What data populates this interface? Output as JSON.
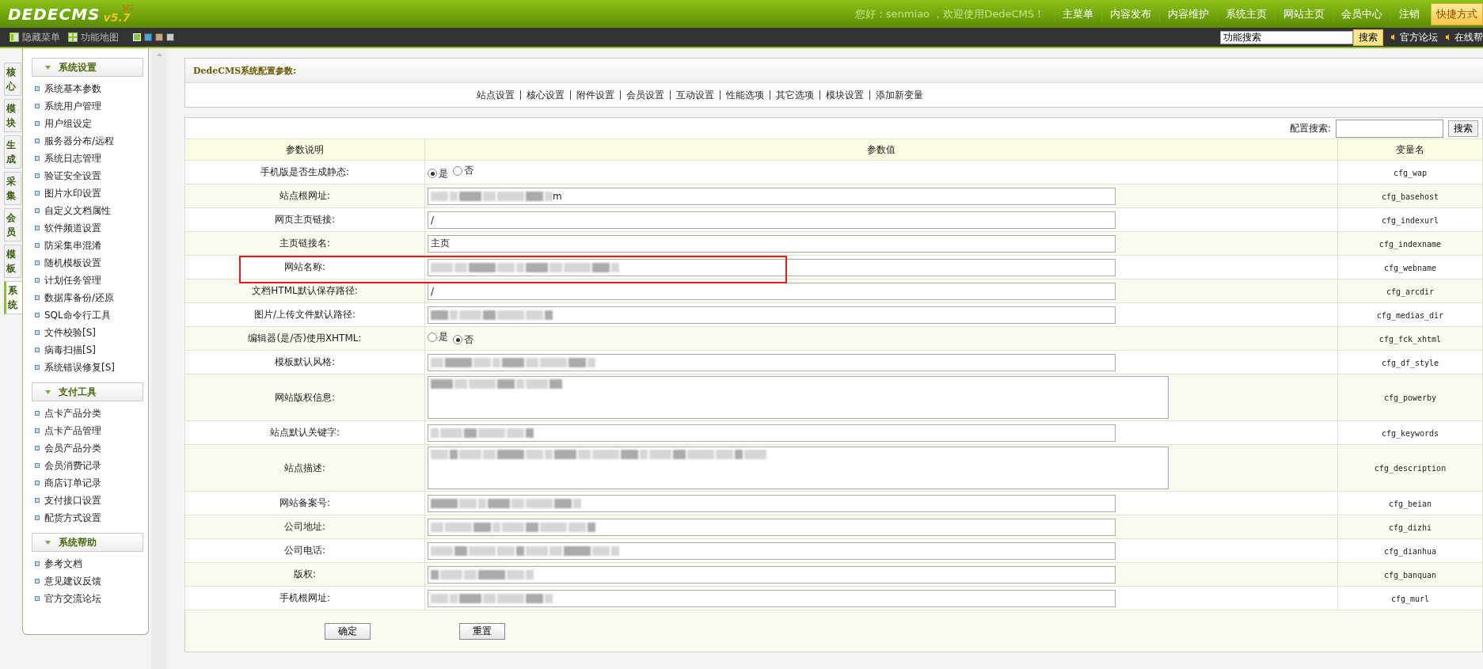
{
  "logo": {
    "name": "DEDECMS",
    "version": "v5.7",
    "edition": "SP2"
  },
  "greeting": "您好：senmiao ，欢迎使用DedeCMS！",
  "top_links": [
    "主菜单",
    "内容发布",
    "内容维护",
    "系统主页",
    "网站主页",
    "会员中心",
    "注销"
  ],
  "shortcut_button": "快捷方式",
  "toolbar": {
    "hide_menu": "隐藏菜单",
    "site_map": "功能地图",
    "skins": [
      {
        "color": "#8cc63f",
        "selected": true
      },
      {
        "color": "#3fa9e0",
        "selected": false
      },
      {
        "color": "#c8a878",
        "selected": false
      },
      {
        "color": "#c8c8c8",
        "selected": false
      }
    ],
    "search_value": "功能搜索",
    "search_button": "搜索",
    "links": [
      "官方论坛",
      "在线帮"
    ]
  },
  "side_tabs": [
    {
      "label": "核心",
      "selected": false
    },
    {
      "label": "模块",
      "selected": false
    },
    {
      "label": "生成",
      "selected": false
    },
    {
      "label": "采集",
      "selected": false
    },
    {
      "label": "会员",
      "selected": false
    },
    {
      "label": "模板",
      "selected": false
    },
    {
      "label": "系统",
      "selected": true
    }
  ],
  "menu_groups": [
    {
      "title": "系统设置",
      "items": [
        "系统基本参数",
        "系统用户管理",
        "用户组设定",
        "服务器分布/远程",
        "系统日志管理",
        "验证安全设置",
        "图片水印设置",
        "自定义文档属性",
        "软件频道设置",
        "防采集串混淆",
        "随机模板设置",
        "计划任务管理",
        "数据库备份/还原",
        "SQL命令行工具",
        "文件校验[S]",
        "病毒扫描[S]",
        "系统错误修复[S]"
      ]
    },
    {
      "title": "支付工具",
      "items": [
        "点卡产品分类",
        "点卡产品管理",
        "会员产品分类",
        "会员消费记录",
        "商店订单记录",
        "支付接口设置",
        "配货方式设置"
      ]
    },
    {
      "title": "系统帮助",
      "items": [
        "参考文档",
        "意见建议反馈",
        "官方交流论坛"
      ]
    }
  ],
  "panel_title": "DedeCMS系统配置参数:",
  "config_tabs": [
    "站点设置",
    "核心设置",
    "附件设置",
    "会员设置",
    "互动设置",
    "性能选项",
    "其它选项",
    "模块设置",
    "添加新变量"
  ],
  "config_search": {
    "label": "配置搜索:",
    "button": "搜索"
  },
  "table": {
    "columns": [
      "参数说明",
      "参数值",
      "变量名"
    ],
    "rows": [
      {
        "label": "手机版是否生成静态:",
        "kind": "radio",
        "options": [
          {
            "label": "是",
            "selected": true
          },
          {
            "label": "否",
            "selected": false
          }
        ],
        "var": "cfg_wap",
        "highlighted": false
      },
      {
        "label": "站点根网址:",
        "kind": "text",
        "blurred": true,
        "value": "m",
        "var": "cfg_basehost",
        "highlighted": false
      },
      {
        "label": "网页主页链接:",
        "kind": "text",
        "blurred": false,
        "value": "/",
        "var": "cfg_indexurl",
        "highlighted": false
      },
      {
        "label": "主页链接名:",
        "kind": "text",
        "blurred": false,
        "value": "主页",
        "var": "cfg_indexname",
        "highlighted": false
      },
      {
        "label": "网站名称:",
        "kind": "text",
        "blurred": true,
        "var": "cfg_webname",
        "highlighted": true
      },
      {
        "label": "文档HTML默认保存路径:",
        "kind": "text",
        "blurred": false,
        "value": "/",
        "var": "cfg_arcdir",
        "highlighted": false
      },
      {
        "label": "图片/上传文件默认路径:",
        "kind": "text",
        "blurred": true,
        "var": "cfg_medias_dir",
        "highlighted": false
      },
      {
        "label": "编辑器(是/否)使用XHTML:",
        "kind": "radio",
        "options": [
          {
            "label": "是",
            "selected": false
          },
          {
            "label": "否",
            "selected": true
          }
        ],
        "var": "cfg_fck_xhtml",
        "highlighted": false
      },
      {
        "label": "模板默认风格:",
        "kind": "text",
        "blurred": true,
        "var": "cfg_df_style",
        "highlighted": false
      },
      {
        "label": "网站版权信息:",
        "kind": "textarea",
        "blurred": true,
        "var": "cfg_powerby",
        "highlighted": false
      },
      {
        "label": "站点默认关键字:",
        "kind": "text",
        "blurred": true,
        "var": "cfg_keywords",
        "highlighted": false
      },
      {
        "label": "站点描述:",
        "kind": "textarea",
        "blurred": true,
        "var": "cfg_description",
        "highlighted": false
      },
      {
        "label": "网站备案号:",
        "kind": "text",
        "blurred": true,
        "var": "cfg_beian",
        "highlighted": false
      },
      {
        "label": "公司地址:",
        "kind": "text",
        "blurred": true,
        "var": "cfg_dizhi",
        "highlighted": false
      },
      {
        "label": "公司电话:",
        "kind": "text",
        "blurred": true,
        "var": "cfg_dianhua",
        "highlighted": false
      },
      {
        "label": "版权:",
        "kind": "text",
        "blurred": true,
        "var": "cfg_banquan",
        "highlighted": false
      },
      {
        "label": "手机根网址:",
        "kind": "text",
        "blurred": true,
        "var": "cfg_murl",
        "highlighted": false
      }
    ]
  },
  "buttons": [
    "确定",
    "重置"
  ]
}
